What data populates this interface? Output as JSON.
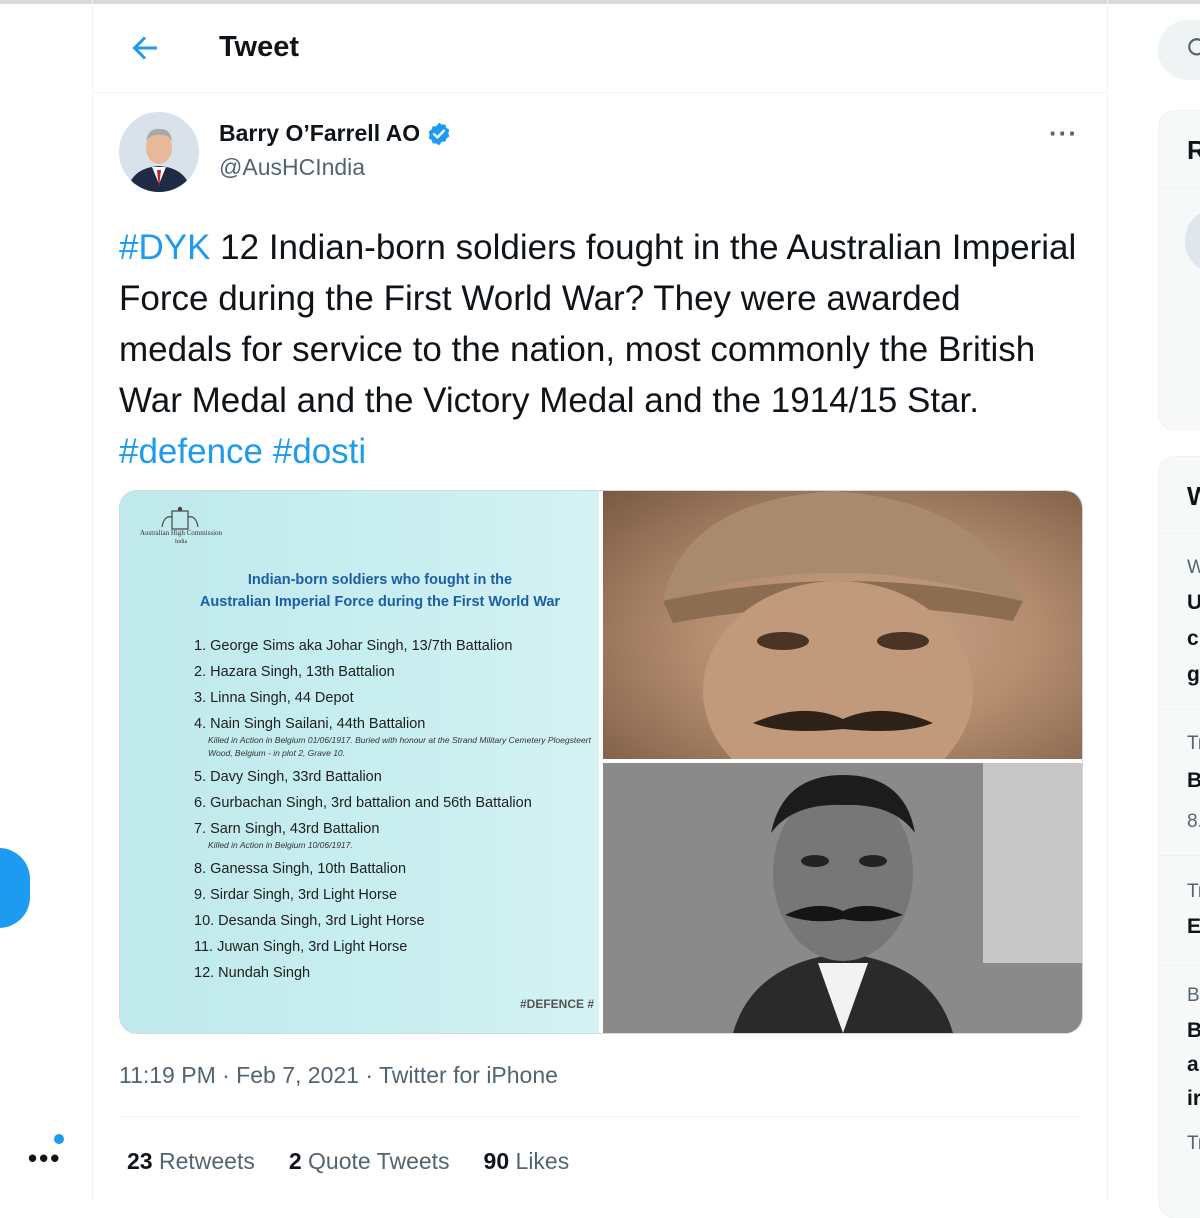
{
  "header": {
    "title": "Tweet"
  },
  "tweet": {
    "author_name": "Barry O’Farrell AO",
    "author_handle": "@AusHCIndia",
    "text_tag1": "#DYK",
    "text_body": " 12 Indian-born soldiers fought in the Australian Imperial Force during the First World War? They were awarded medals for service to the nation, most commonly the British War Medal and the Victory Medal and the 1914/15 Star. ",
    "text_tag2": "#defence",
    "text_tag3": "#dosti",
    "timestamp": "11:19 PM · Feb 7, 2021 · Twitter for iPhone",
    "stats": {
      "retweets_count": "23",
      "retweets_label": "Retweets",
      "quotes_count": "2",
      "quotes_label": "Quote Tweets",
      "likes_count": "90",
      "likes_label": "Likes"
    }
  },
  "image": {
    "crest_text": "Australian High Commission",
    "crest_sub": "India",
    "title_line1": "Indian-born soldiers who fought in the",
    "title_line2": "Australian Imperial Force during the First World War",
    "soldiers": [
      "1. George Sims aka Johar Singh, 13/7th Battalion",
      "2. Hazara Singh, 13th Battalion",
      "3. Linna Singh, 44 Depot",
      "4. Nain Singh Sailani, 44th Battalion",
      "Killed in Action in Belgium 01/06/1917. Buried with honour at the Strand Military Cemetery Ploegsteert Wood, Belgium - in plot 2, Grave 10.",
      "5. Davy Singh, 33rd Battalion",
      "6. Gurbachan Singh, 3rd battalion and 56th Battalion",
      "7. Sarn Singh, 43rd Battalion",
      "Killed in Action in Belgium 10/06/1917.",
      "8. Ganessa Singh, 10th Battalion",
      "9. Sirdar Singh, 3rd Light Horse",
      "10. Desanda Singh, 3rd Light Horse",
      "11. Juwan Singh, 3rd Light Horse",
      "12. Nundah Singh"
    ],
    "hashtag": "#DEFENCE #"
  },
  "sidebar": {
    "card_a_head": "R",
    "card_b_head": "W",
    "trends": [
      {
        "line1": "W",
        "line2": "U",
        "line3": "c",
        "line4": "g"
      },
      {
        "line1": "Tr",
        "line2": "B",
        "line3": "8."
      },
      {
        "line1": "Tr",
        "line2": "E"
      },
      {
        "line1": "B",
        "line2": "B",
        "line3": "a",
        "line4": "ir",
        "line5": "Tr"
      }
    ]
  },
  "colors": {
    "accent": "#1d9bf0",
    "text": "#0f1419",
    "muted": "#536471"
  },
  "icons": [
    "back-arrow-icon",
    "verified-icon",
    "more-icon",
    "search-icon"
  ]
}
